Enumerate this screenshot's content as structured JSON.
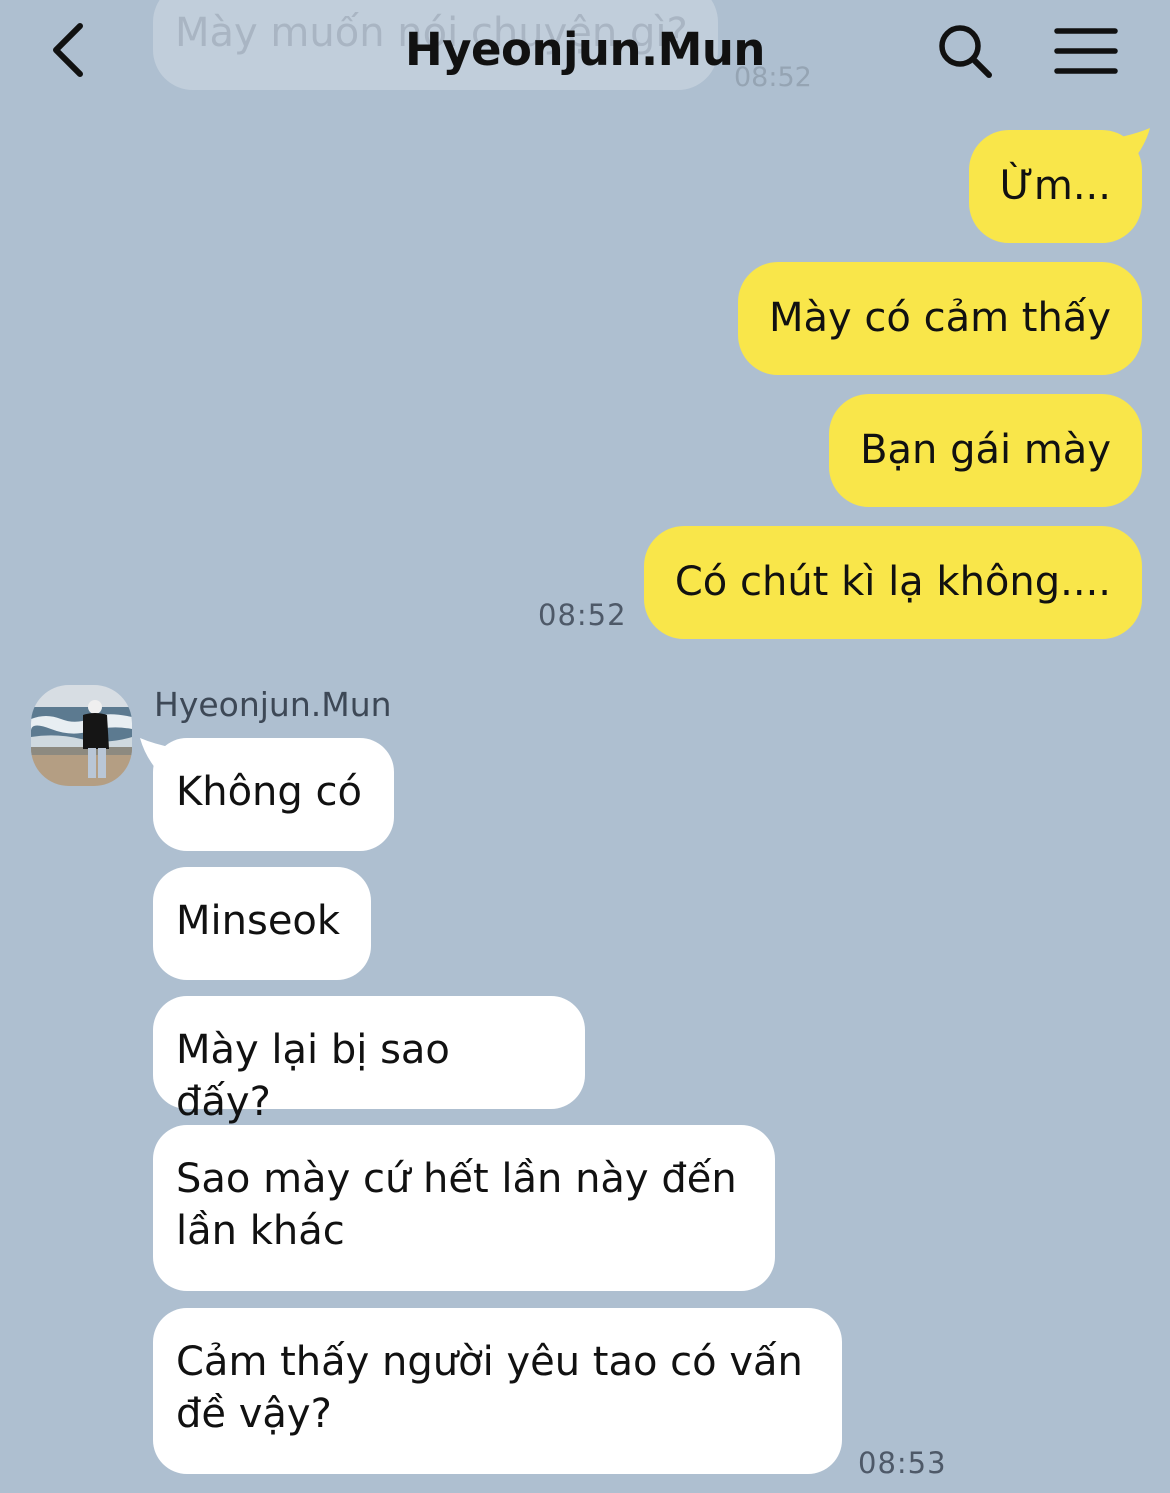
{
  "header": {
    "title": "Hyeonjun.Mun",
    "back_icon": "chevron-left-icon",
    "search_icon": "search-icon",
    "menu_icon": "hamburger-menu-icon"
  },
  "previous_message": {
    "text": "Mày muốn nói chuyện gì?",
    "time": "08:52"
  },
  "outgoing": {
    "messages": [
      "Ừm...",
      "Mày có cảm thấy",
      "Bạn gái mày",
      "Có chút kì lạ không...."
    ],
    "time": "08:52",
    "bubble_color": "#f9e64a"
  },
  "incoming": {
    "sender_name": "Hyeonjun.Mun",
    "messages": [
      "Không có",
      "Minseok",
      "Mày lại bị sao đấy?",
      "Sao mày cứ hết lần này đến lần khác",
      "Cảm thấy người yêu tao có vấn đề vậy?"
    ],
    "time": "08:53",
    "bubble_color": "#ffffff"
  },
  "colors": {
    "background": "#aebfd0",
    "text": "#111111",
    "timestamp": "#4e5968"
  }
}
